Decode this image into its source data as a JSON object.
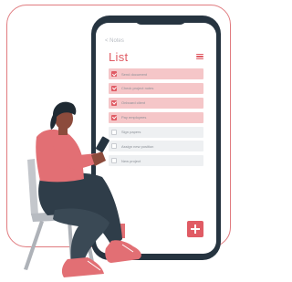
{
  "app": {
    "back_label": "< Notes",
    "title": "List"
  },
  "list": {
    "items": [
      {
        "label": "Send document",
        "checked": true
      },
      {
        "label": "Check project notes",
        "checked": true
      },
      {
        "label": "Onboard client",
        "checked": true
      },
      {
        "label": "Pay employees",
        "checked": true
      },
      {
        "label": "Sign papers",
        "checked": false
      },
      {
        "label": "Assign new position",
        "checked": false
      },
      {
        "label": "New project",
        "checked": false
      }
    ]
  },
  "icons": {
    "menu": "hamburger-menu-icon",
    "add": "plus-icon",
    "check": "checkmark-icon"
  },
  "colors": {
    "accent": "#e05b64",
    "phone_body": "#263440",
    "checked_row": "#f5c6c8",
    "unchecked_row": "#eef0f2"
  }
}
